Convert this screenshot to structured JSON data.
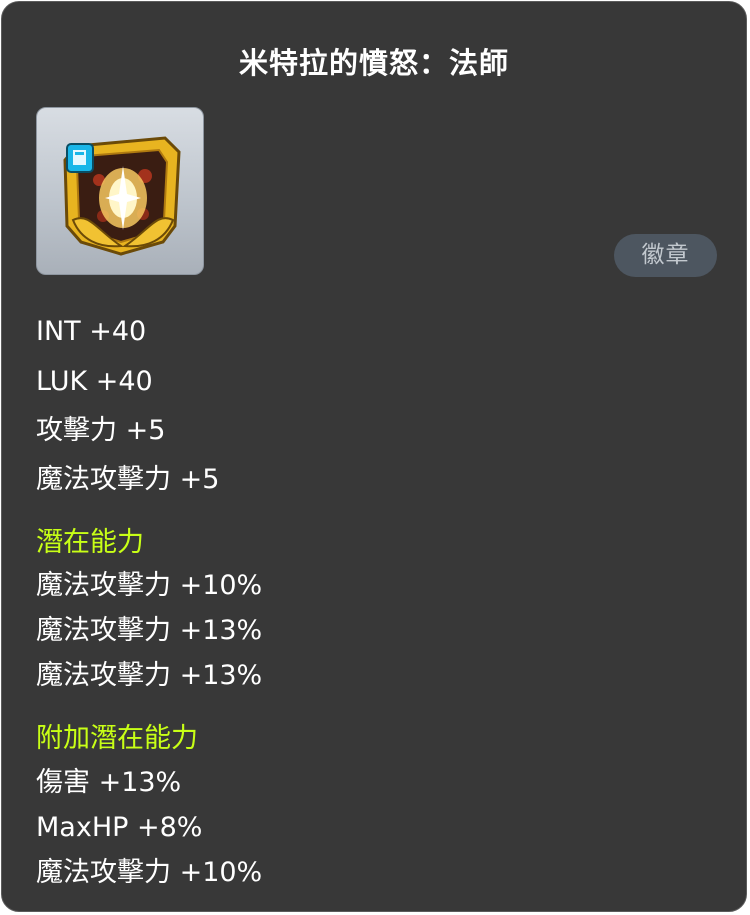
{
  "item": {
    "title": "米特拉的憤怒：法師",
    "icon": "mitra-rage-emblem-icon",
    "type_badge": "徽章"
  },
  "base_stats": [
    "INT +40",
    "LUK +40",
    "攻擊力 +5",
    "魔法攻擊力 +5"
  ],
  "potential": {
    "heading": "潛在能力",
    "lines": [
      "魔法攻擊力 +10%",
      "魔法攻擊力 +13%",
      "魔法攻擊力 +13%"
    ]
  },
  "additional_potential": {
    "heading": "附加潛在能力",
    "lines": [
      "傷害 +13%",
      "MaxHP +8%",
      "魔法攻擊力 +10%"
    ]
  },
  "colors": {
    "background": "#383838",
    "text": "#ffffff",
    "section_heading": "#c8ff16",
    "badge_bg": "#4d5660",
    "badge_text": "#c3c9cf"
  }
}
